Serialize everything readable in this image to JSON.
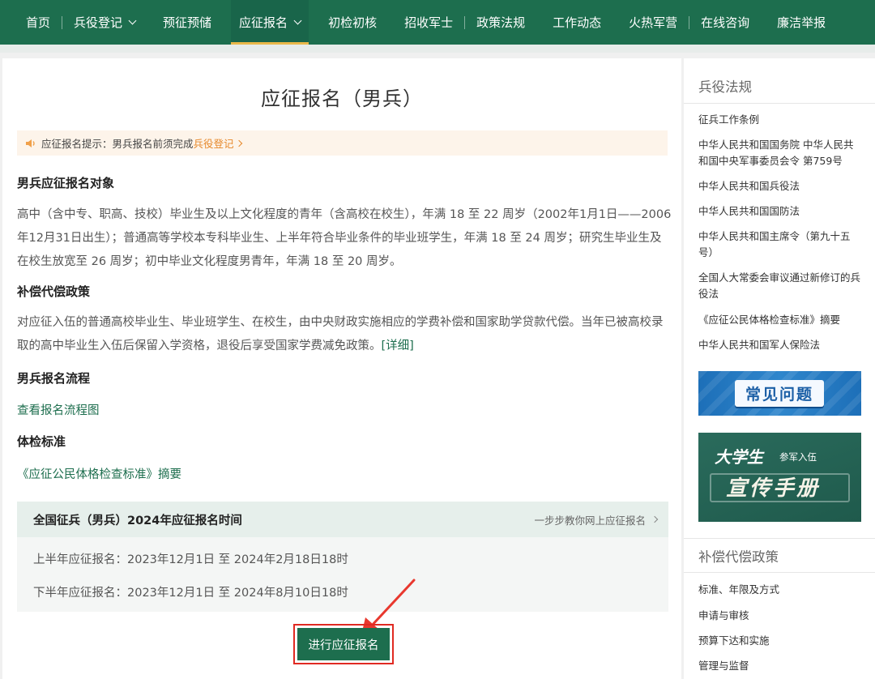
{
  "nav": {
    "items": [
      {
        "label": "首页",
        "dropdown": false,
        "active": false
      },
      {
        "label": "兵役登记",
        "dropdown": true,
        "active": false
      },
      {
        "label": "预征预储",
        "dropdown": false,
        "active": false
      },
      {
        "label": "应征报名",
        "dropdown": true,
        "active": true
      },
      {
        "label": "初检初核",
        "dropdown": false,
        "active": false
      },
      {
        "label": "招收军士",
        "dropdown": false,
        "active": false
      },
      {
        "label": "政策法规",
        "dropdown": false,
        "active": false
      },
      {
        "label": "工作动态",
        "dropdown": false,
        "active": false
      },
      {
        "label": "火热军营",
        "dropdown": false,
        "active": false
      },
      {
        "label": "在线咨询",
        "dropdown": false,
        "active": false
      },
      {
        "label": "廉洁举报",
        "dropdown": false,
        "active": false
      }
    ]
  },
  "main": {
    "title": "应征报名（男兵）",
    "notice": {
      "text": "应征报名提示：男兵报名前须完成",
      "link": "兵役登记"
    },
    "sections": {
      "target_title": "男兵应征报名对象",
      "target_text": "高中（含中专、职高、技校）毕业生及以上文化程度的青年（含高校在校生），年满 18 至 22 周岁（2002年1月1日——2006年12月31日出生）；普通高等学校本专科毕业生、上半年符合毕业条件的毕业班学生，年满 18 至 24 周岁；研究生毕业生及在校生放宽至 26 周岁；初中毕业文化程度男青年，年满 18 至 20 周岁。",
      "comp_title": "补偿代偿政策",
      "comp_text": "对应征入伍的普通高校毕业生、毕业班学生、在校生，由中央财政实施相应的学费补偿和国家助学贷款代偿。当年已被高校录取的高中毕业生入伍后保留入学资格，退役后享受国家学费减免政策。",
      "comp_link": "[详细]",
      "flow_title": "男兵报名流程",
      "flow_link": "查看报名流程图",
      "exam_title": "体检标准",
      "exam_link": "《应征公民体格检查标准》摘要"
    },
    "timebox": {
      "title": "全国征兵（男兵）2024年应征报名时间",
      "guide": "一步步教你网上应征报名",
      "first_half": "上半年应征报名：2023年12月1日 至 2024年2月18日18时",
      "second_half": "下半年应征报名：2023年12月1日 至 2024年8月10日18时"
    },
    "submit_label": "进行应征报名",
    "colors": {
      "brand": "#1d6e4e",
      "accent": "#e9b84a",
      "highlight": "#e02a22",
      "notice_link": "#e6882a"
    }
  },
  "sidebar": {
    "laws_title": "兵役法规",
    "laws": [
      "征兵工作条例",
      "中华人民共和国国务院 中华人民共和国中央军事委员会令 第759号",
      "中华人民共和国兵役法",
      "中华人民共和国国防法",
      "中华人民共和国主席令（第九十五号）",
      "全国人大常委会审议通过新修订的兵役法",
      "《应征公民体格检查标准》摘要",
      "中华人民共和国军人保险法"
    ],
    "banner_faq": "常见问题",
    "banner_handbook_big": "大学生",
    "banner_handbook_small": "参军入伍",
    "banner_handbook_main": "宣传手册",
    "comp_title": "补偿代偿政策",
    "comp_items": [
      "标准、年限及方式",
      "申请与审核",
      "预算下达和实施",
      "管理与监督"
    ]
  }
}
